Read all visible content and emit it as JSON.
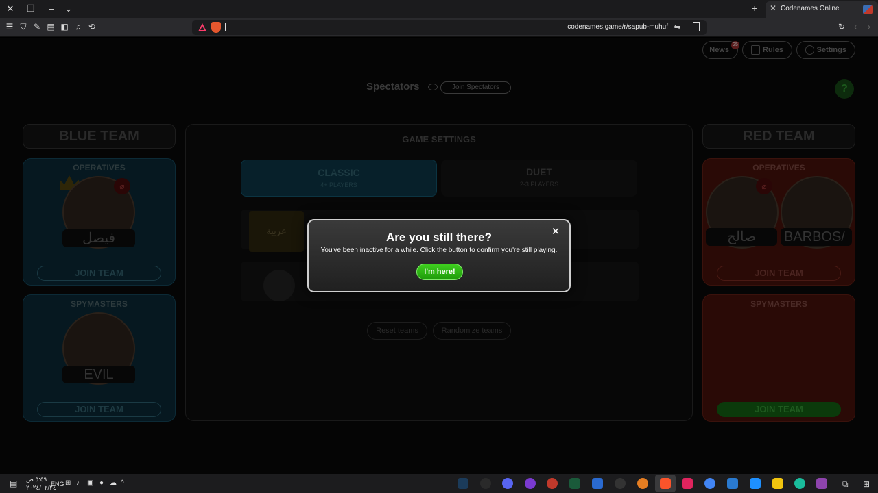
{
  "browser": {
    "tab_title": "Codenames Online",
    "url": "codenames.game/r/sapub-muhuf"
  },
  "page": {
    "header_buttons": [
      {
        "label": "News",
        "badge": "25"
      },
      {
        "label": "Rules"
      },
      {
        "label": "Settings"
      }
    ],
    "spectators": {
      "label": "Spectators",
      "join_label": "Join Spectators"
    },
    "help_label": "?",
    "blue_team": {
      "title": "BLUE TEAM",
      "operatives": {
        "heading": "OPERATIVES",
        "players": [
          "فيصل"
        ],
        "join_label": "JOIN TEAM"
      },
      "spymasters": {
        "heading": "SPYMASTERS",
        "players": [
          "EVIL"
        ],
        "join_label": "JOIN TEAM"
      }
    },
    "red_team": {
      "title": "RED TEAM",
      "operatives": {
        "heading": "OPERATIVES",
        "players": [
          "صالح",
          "BARBOS/"
        ],
        "join_label": "JOIN TEAM"
      },
      "spymasters": {
        "heading": "SPYMASTERS",
        "players": [],
        "join_label": "JOIN TEAM"
      }
    },
    "game_settings": {
      "title": "GAME SETTINGS",
      "modes": [
        {
          "title": "CLASSIC",
          "subtitle": "4+ PLAYERS"
        },
        {
          "title": "DUET",
          "subtitle": "2-3 PLAYERS"
        }
      ],
      "language_card": "عربية",
      "reset_label": "Reset teams",
      "randomize_label": "Randomize teams"
    }
  },
  "modal": {
    "title": "Are you still there?",
    "message": "You've been inactive for a while. Click the button to confirm you're still playing.",
    "button_label": "I'm here!"
  },
  "taskbar": {
    "time": "٥:٥٩ ص",
    "date": "٢٠٢٤/٠٢/٢٤",
    "language": "ENG"
  }
}
